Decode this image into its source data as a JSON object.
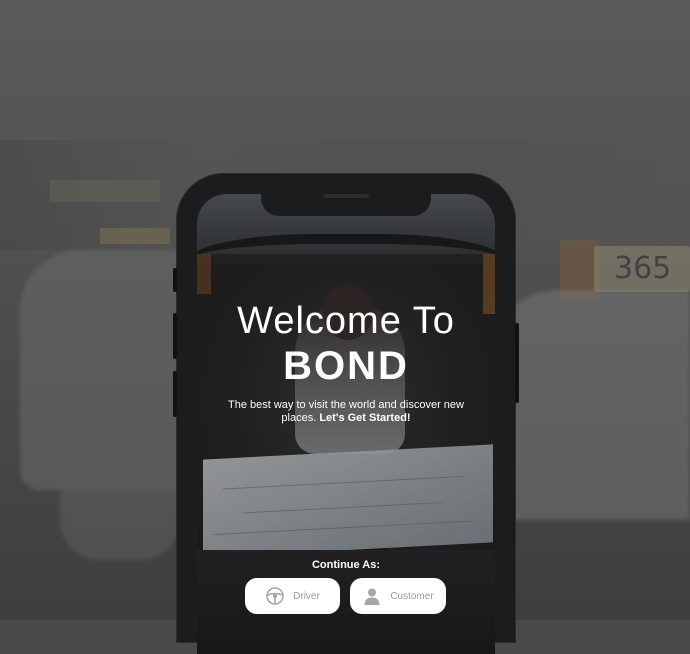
{
  "hero": {
    "welcome_line": "Welcome To",
    "brand_name": "BOND",
    "tagline_main": "The best way to visit the world and discover new places.",
    "tagline_cta": "Let's Get Started!"
  },
  "continue_prompt": "Continue As:",
  "roles": [
    {
      "label": "Driver",
      "icon": "steering-wheel-icon"
    },
    {
      "label": "Customer",
      "icon": "person-icon"
    }
  ],
  "background": {
    "plate_text": "365"
  },
  "colors": {
    "button_bg": "#ffffff",
    "button_text": "#9b9b9b",
    "phone_frame": "#1b1c1e"
  }
}
